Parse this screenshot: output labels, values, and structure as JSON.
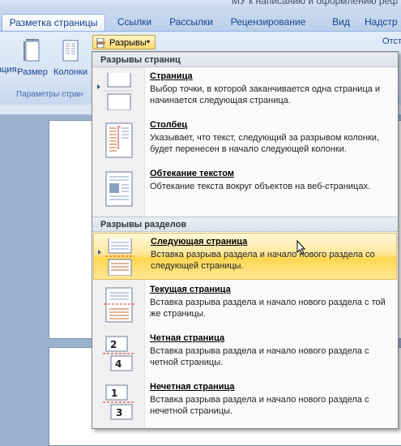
{
  "window": {
    "title": "МУ к написанию и оформлению реф"
  },
  "tabs": [
    {
      "label": "Разметка страницы",
      "active": true
    },
    {
      "label": "Ссылки"
    },
    {
      "label": "Рассылки"
    },
    {
      "label": "Рецензирование"
    },
    {
      "label": "Вид"
    },
    {
      "label": "Надстр"
    }
  ],
  "ribbon": {
    "orientation_label": "ация",
    "size_label": "Размер",
    "columns_label": "Колонки",
    "breaks_button": "Разрывы",
    "group_label": "Параметры стран",
    "right_partial": "Отст"
  },
  "menu": {
    "section_page_breaks": "Разрывы страниц",
    "section_section_breaks": "Разрывы разделов",
    "items": [
      {
        "title": "Страница",
        "desc": "Выбор точки, в которой заканчивается одна страница и начинается следующая страница."
      },
      {
        "title": "Столбец",
        "desc": "Указывает, что текст, следующий за разрывом колонки, будет перенесен в начало следующей колонки."
      },
      {
        "title": "Обтекание текстом",
        "desc": "Обтекание текста вокруг объектов на веб-страницах."
      },
      {
        "title": "Следующая страница",
        "desc": "Вставка разрыва раздела и начало нового раздела со следующей страницы.",
        "highlighted": true
      },
      {
        "title": "Текущая страница",
        "desc": "Вставка разрыва раздела и начало нового раздела с той же страницы."
      },
      {
        "title": "Четная страница",
        "desc": "Вставка разрыва раздела и начало нового раздела с четной страницы."
      },
      {
        "title": "Нечетная страница",
        "desc": "Вставка разрыва раздела и начало нового раздела с нечетной страницы."
      }
    ]
  },
  "icon_digits": {
    "even_a": "2",
    "even_b": "4",
    "odd_a": "1",
    "odd_b": "3"
  },
  "colors": {
    "accent": "#15428b",
    "hover": "#ffd74f",
    "menu_header": "#dde3ea"
  }
}
